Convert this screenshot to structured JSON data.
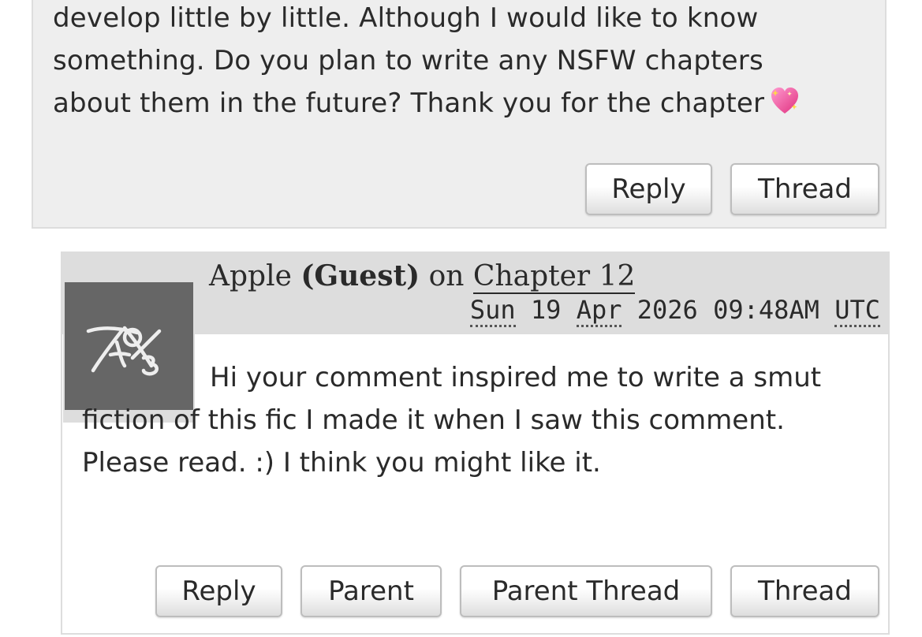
{
  "parent_comment": {
    "line1": "develop little by little. Although I would like to know",
    "line2": "something. Do you plan to write any NSFW chapters",
    "line3": "about them in the future? Thank you for the chapter",
    "emoji_icon": "sparkling-heart-icon",
    "buttons": {
      "reply": "Reply",
      "thread": "Thread"
    }
  },
  "child_comment": {
    "author": "Apple",
    "guest_tag": "(Guest)",
    "on_word": "on",
    "chapter": "Chapter 12",
    "date": {
      "weekday": "Sun",
      "day": "19",
      "month": "Apr",
      "year": "2026",
      "time": "09:48AM",
      "tz": "UTC"
    },
    "avatar_icon": "ao3-logo-icon",
    "body": "Hi your comment inspired me to write a smut fiction of this fic I made it when I saw this comment. Please read. :) I think you might like it.",
    "buttons": {
      "reply": "Reply",
      "parent": "Parent",
      "parent_thread": "Parent Thread",
      "thread": "Thread"
    }
  },
  "colors": {
    "parent_bg": "#eeeeee",
    "header_bg": "#dddddd",
    "avatar_bg": "#666666",
    "text": "#2a2a2a"
  }
}
